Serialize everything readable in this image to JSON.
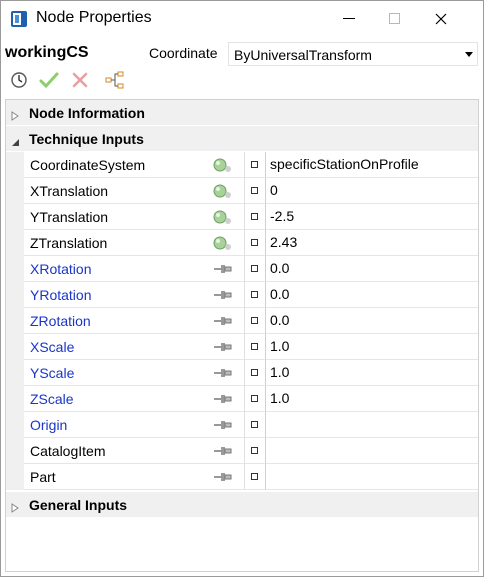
{
  "window": {
    "title": "Node Properties",
    "icon": "catia-app-icon"
  },
  "header": {
    "node_name": "workingCS",
    "coordinate_label": "Coordinate",
    "coordinate_value": "ByUniversalTransform"
  },
  "toolbar": {
    "items": [
      "history-icon",
      "check-icon",
      "cross-icon",
      "tree-icon"
    ]
  },
  "sections": {
    "node_information": "Node Information",
    "technique_inputs": "Technique Inputs",
    "general_inputs": "General Inputs"
  },
  "rows": [
    {
      "name": "CoordinateSystem",
      "link": false,
      "icon": "globe-icon",
      "value": "specificStationOnProfile"
    },
    {
      "name": "XTranslation",
      "link": false,
      "icon": "globe-icon",
      "value": "0"
    },
    {
      "name": "YTranslation",
      "link": false,
      "icon": "globe-icon",
      "value": "-2.5"
    },
    {
      "name": "ZTranslation",
      "link": false,
      "icon": "globe-icon",
      "value": "2.43"
    },
    {
      "name": "XRotation",
      "link": true,
      "icon": "pin-icon",
      "value": "0.0"
    },
    {
      "name": "YRotation",
      "link": true,
      "icon": "pin-icon",
      "value": "0.0"
    },
    {
      "name": "ZRotation",
      "link": true,
      "icon": "pin-icon",
      "value": "0.0"
    },
    {
      "name": "XScale",
      "link": true,
      "icon": "pin-icon",
      "value": "1.0"
    },
    {
      "name": "YScale",
      "link": true,
      "icon": "pin-icon",
      "value": "1.0"
    },
    {
      "name": "ZScale",
      "link": true,
      "icon": "pin-icon",
      "value": "1.0"
    },
    {
      "name": "Origin",
      "link": true,
      "icon": "pin-icon",
      "value": ""
    },
    {
      "name": "CatalogItem",
      "link": false,
      "icon": "pin-icon",
      "value": ""
    },
    {
      "name": "Part",
      "link": false,
      "icon": "pin-icon",
      "value": ""
    }
  ],
  "colors": {
    "link_text": "#1a35c8",
    "section_bg": "#f0f0f0",
    "check_green": "#6cc04a",
    "cross_red": "#e06b6b"
  }
}
